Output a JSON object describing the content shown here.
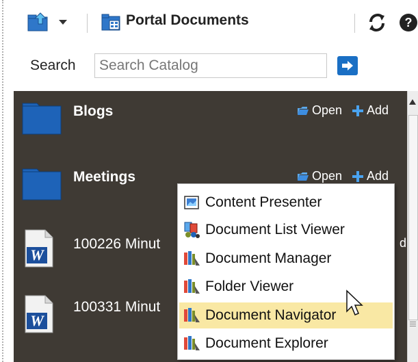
{
  "toolbar": {
    "title": "Portal Documents",
    "icons": [
      "up-folder-icon",
      "dropdown-arrow-icon",
      "portal-documents-icon",
      "refresh-icon",
      "help-icon"
    ]
  },
  "search": {
    "label": "Search",
    "placeholder": "Search Catalog",
    "go_icon": "arrow-right-icon"
  },
  "items": [
    {
      "title": "Blogs",
      "type": "folder",
      "open_label": "Open",
      "add_label": "Add"
    },
    {
      "title": "Meetings",
      "type": "folder",
      "open_label": "Open",
      "add_label": "Add"
    },
    {
      "title": "100226 Minut",
      "type": "word-document",
      "add_label": "d"
    },
    {
      "title": "100331 Minut",
      "type": "word-document"
    }
  ],
  "add_menu": {
    "items": [
      {
        "label": "Content Presenter",
        "icon": "content-presenter-icon"
      },
      {
        "label": "Document List Viewer",
        "icon": "document-list-viewer-icon"
      },
      {
        "label": "Document Manager",
        "icon": "document-manager-icon"
      },
      {
        "label": "Folder Viewer",
        "icon": "folder-viewer-icon"
      },
      {
        "label": "Document Navigator",
        "icon": "document-navigator-icon",
        "hovered": true
      },
      {
        "label": "Document Explorer",
        "icon": "document-explorer-icon"
      }
    ]
  },
  "colors": {
    "panel_bg": "#3f3a34",
    "folder_blue": "#1e63b8",
    "accent_blue": "#1a6fc4",
    "menu_hover": "#f9e8a4"
  }
}
